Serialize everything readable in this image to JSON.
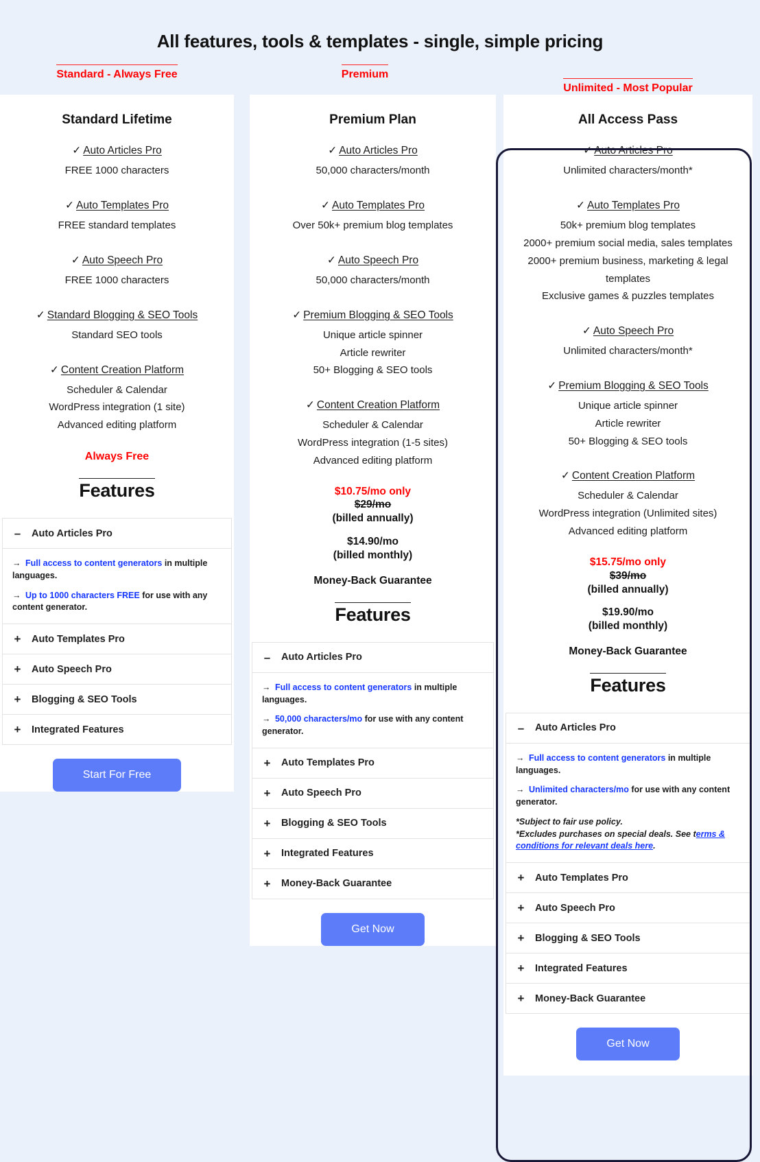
{
  "page": {
    "title": "All features, tools & templates - single, simple pricing",
    "features_heading": "Features",
    "accent_red": "#ff0000",
    "accent_blue": "#1536ff",
    "cta_color": "#5c7cfa",
    "popular_border": "#171735"
  },
  "plans": [
    {
      "badge": "Standard - Always Free",
      "name": "Standard Lifetime",
      "groups": [
        {
          "check": "✓",
          "head": "Auto Articles Pro",
          "lines": [
            "FREE 1000 characters"
          ]
        },
        {
          "check": "✓",
          "head": "Auto Templates Pro",
          "lines": [
            "FREE standard templates"
          ]
        },
        {
          "check": "✓",
          "head": "Auto Speech Pro",
          "lines": [
            "FREE 1000 characters"
          ]
        },
        {
          "check": "✓",
          "head": "Standard Blogging & SEO Tools",
          "lines": [
            "Standard SEO tools"
          ]
        },
        {
          "check": "✓",
          "head": "Content Creation Platform",
          "lines": [
            "Scheduler & Calendar",
            "WordPress integration (1 site)",
            "Advanced editing platform"
          ]
        }
      ],
      "free_label": "Always Free",
      "price": null,
      "accordion": [
        {
          "icon": "–",
          "label": "Auto Articles Pro",
          "expanded": true,
          "body": [
            {
              "arrow": "→",
              "highlight": "Full access to content generators",
              "rest": " in multiple languages."
            },
            {
              "arrow": "→",
              "highlight": "Up to 1000 characters FREE",
              "rest": " for use with any content generator."
            }
          ]
        },
        {
          "icon": "+",
          "label": "Auto Templates Pro",
          "expanded": false
        },
        {
          "icon": "+",
          "label": "Auto Speech Pro",
          "expanded": false
        },
        {
          "icon": "+",
          "label": "Blogging & SEO Tools",
          "expanded": false
        },
        {
          "icon": "+",
          "label": "Integrated Features",
          "expanded": false
        }
      ],
      "cta": "Start For Free"
    },
    {
      "badge": "Premium",
      "name": "Premium Plan",
      "groups": [
        {
          "check": "✓",
          "head": "Auto Articles Pro",
          "lines": [
            "50,000 characters/month"
          ]
        },
        {
          "check": "✓",
          "head": "Auto Templates Pro",
          "lines": [
            "Over 50k+ premium blog templates"
          ]
        },
        {
          "check": "✓",
          "head": "Auto Speech Pro",
          "lines": [
            "50,000 characters/month"
          ]
        },
        {
          "check": "✓",
          "head": "Premium Blogging & SEO Tools",
          "lines": [
            "Unique article spinner",
            "Article rewriter",
            "50+ Blogging & SEO tools"
          ]
        },
        {
          "check": "✓",
          "head": "Content Creation Platform",
          "lines": [
            "Scheduler & Calendar",
            "WordPress integration (1-5 sites)",
            "Advanced editing platform"
          ]
        }
      ],
      "free_label": null,
      "price": {
        "promo": "$10.75/mo only",
        "struck": "$29/mo",
        "annual_note": "(billed annually)",
        "monthly": "$14.90/mo",
        "monthly_note": "(billed monthly)",
        "guarantee": "Money-Back Guarantee"
      },
      "accordion": [
        {
          "icon": "–",
          "label": "Auto Articles Pro",
          "expanded": true,
          "body": [
            {
              "arrow": "→",
              "highlight": "Full access to content generators",
              "rest": " in multiple languages."
            },
            {
              "arrow": "→",
              "highlight": "50,000 characters/mo",
              "rest": " for use with any content generator."
            }
          ]
        },
        {
          "icon": "+",
          "label": "Auto Templates Pro",
          "expanded": false
        },
        {
          "icon": "+",
          "label": "Auto Speech Pro",
          "expanded": false
        },
        {
          "icon": "+",
          "label": "Blogging & SEO Tools",
          "expanded": false
        },
        {
          "icon": "+",
          "label": "Integrated Features",
          "expanded": false
        },
        {
          "icon": "+",
          "label": "Money-Back Guarantee",
          "expanded": false
        }
      ],
      "cta": "Get Now"
    },
    {
      "badge": "Unlimited - Most Popular",
      "name": "All Access Pass",
      "groups": [
        {
          "check": "✓",
          "head": "Auto Articles Pro",
          "lines": [
            "Unlimited characters/month*"
          ]
        },
        {
          "check": "✓",
          "head": "Auto Templates Pro",
          "lines": [
            "50k+ premium blog templates",
            "2000+ premium social media, sales templates",
            "2000+ premium business, marketing & legal templates",
            "Exclusive games & puzzles templates"
          ]
        },
        {
          "check": "✓",
          "head": "Auto Speech Pro",
          "lines": [
            "Unlimited characters/month*"
          ]
        },
        {
          "check": "✓",
          "head": "Premium Blogging & SEO Tools",
          "lines": [
            "Unique article spinner",
            "Article rewriter",
            "50+ Blogging & SEO tools"
          ]
        },
        {
          "check": "✓",
          "head": "Content Creation Platform",
          "lines": [
            "Scheduler & Calendar",
            "WordPress integration (Unlimited sites)",
            "Advanced editing platform"
          ]
        }
      ],
      "free_label": null,
      "price": {
        "promo": "$15.75/mo only",
        "struck": "$39/mo",
        "annual_note": "(billed annually)",
        "monthly": "$19.90/mo",
        "monthly_note": "(billed monthly)",
        "guarantee": "Money-Back Guarantee"
      },
      "accordion": [
        {
          "icon": "–",
          "label": "Auto Articles Pro",
          "expanded": true,
          "body": [
            {
              "arrow": "→",
              "highlight": "Full access to content generators",
              "rest": " in multiple languages."
            },
            {
              "arrow": "→",
              "highlight": "Unlimited characters/mo",
              "rest": " for use with any content generator."
            }
          ],
          "fine_print": {
            "line1": "*Subject to fair use policy.",
            "line2_pre": "*Excludes purchases on special deals. See t",
            "line2_link": "erms & conditions for relevant deals here",
            "line2_post": "."
          }
        },
        {
          "icon": "+",
          "label": "Auto Templates Pro",
          "expanded": false
        },
        {
          "icon": "+",
          "label": "Auto Speech Pro",
          "expanded": false
        },
        {
          "icon": "+",
          "label": "Blogging & SEO Tools",
          "expanded": false
        },
        {
          "icon": "+",
          "label": "Integrated Features",
          "expanded": false
        },
        {
          "icon": "+",
          "label": "Money-Back Guarantee",
          "expanded": false
        }
      ],
      "cta": "Get Now"
    }
  ]
}
